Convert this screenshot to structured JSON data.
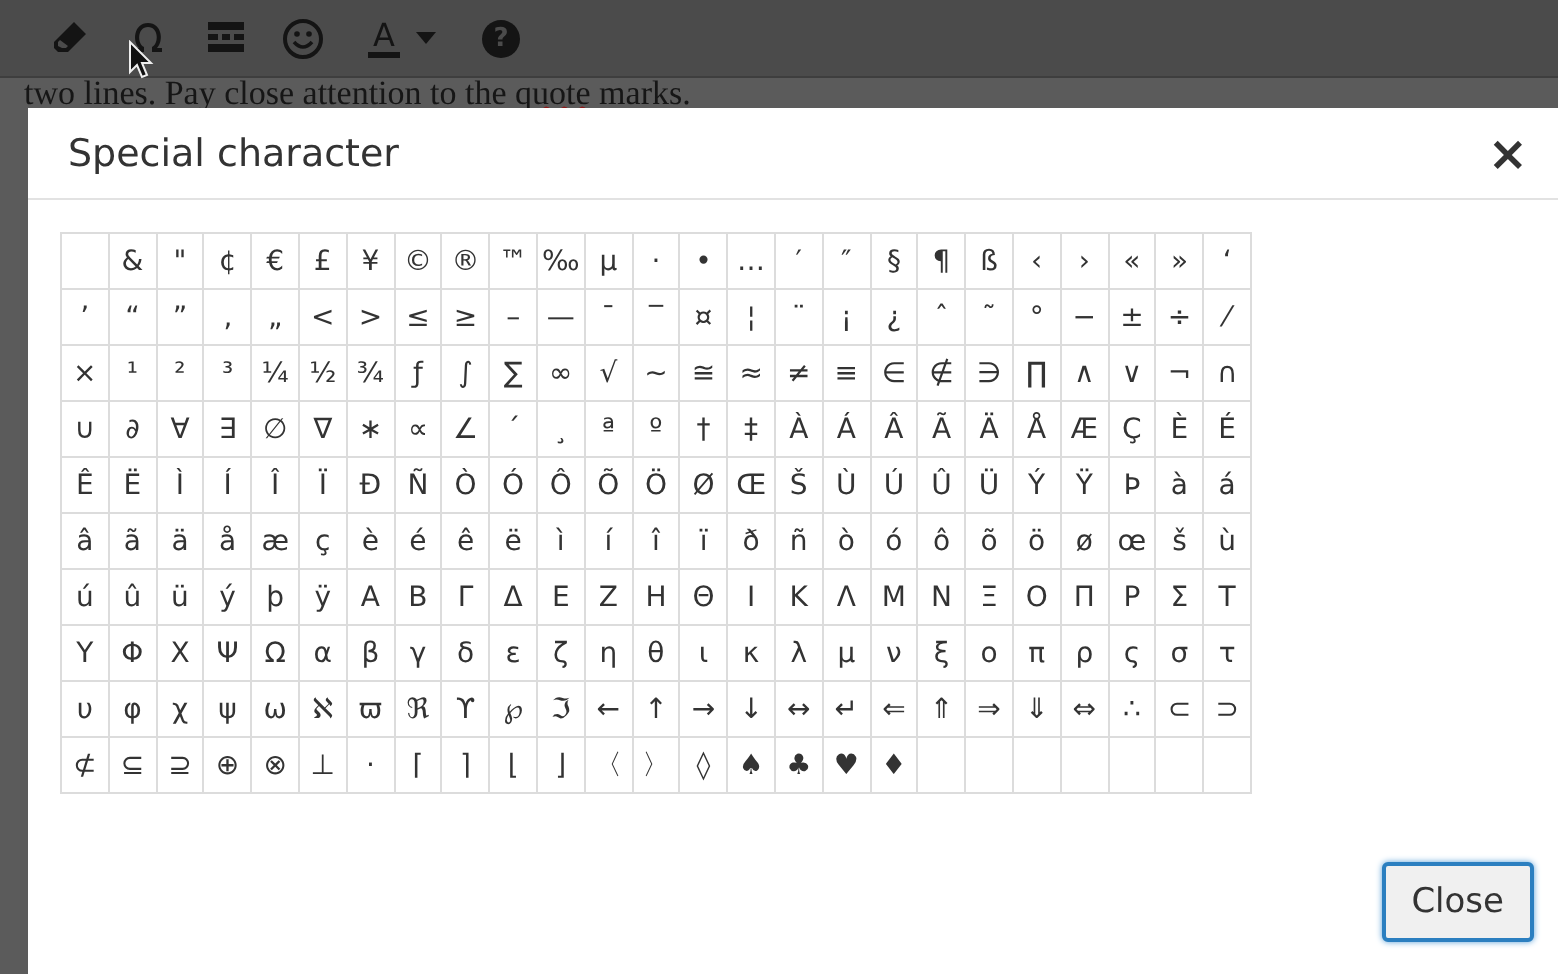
{
  "toolbar": [
    {
      "kind": "eraser"
    },
    {
      "kind": "omega"
    },
    {
      "kind": "hr"
    },
    {
      "kind": "emoticon"
    },
    {
      "kind": "textcolor",
      "glyph": "A"
    },
    {
      "kind": "help",
      "glyph": "?"
    }
  ],
  "editor_line": [
    {
      "text": "two lines. Pay close attention to the ",
      "misspelled": false
    },
    {
      "text": "quote",
      "misspelled": true
    },
    {
      "text": " marks.",
      "misspelled": false
    }
  ],
  "dialog": {
    "title": "Special character",
    "close_glyph": "×",
    "rows": [
      [
        " ",
        "&",
        "\"",
        "¢",
        "€",
        "£",
        "¥",
        "©",
        "®",
        "™",
        "‰",
        "µ",
        "·",
        "•",
        "…",
        "′",
        "″",
        "§",
        "¶",
        "ß",
        "‹",
        "›",
        "«",
        "»",
        "‘"
      ],
      [
        "’",
        "“",
        "”",
        "‚",
        "„",
        "<",
        ">",
        "≤",
        "≥",
        "–",
        "—",
        "¯",
        "‾",
        "¤",
        "¦",
        "¨",
        "¡",
        "¿",
        "ˆ",
        "˜",
        "°",
        "−",
        "±",
        "÷",
        "⁄"
      ],
      [
        "×",
        "¹",
        "²",
        "³",
        "¼",
        "½",
        "¾",
        "ƒ",
        "∫",
        "∑",
        "∞",
        "√",
        "∼",
        "≅",
        "≈",
        "≠",
        "≡",
        "∈",
        "∉",
        "∋",
        "∏",
        "∧",
        "∨",
        "¬",
        "∩"
      ],
      [
        "∪",
        "∂",
        "∀",
        "∃",
        "∅",
        "∇",
        "∗",
        "∝",
        "∠",
        "´",
        "¸",
        "ª",
        "º",
        "†",
        "‡",
        "À",
        "Á",
        "Â",
        "Ã",
        "Ä",
        "Å",
        "Æ",
        "Ç",
        "È",
        "É"
      ],
      [
        "Ê",
        "Ë",
        "Ì",
        "Í",
        "Î",
        "Ï",
        "Ð",
        "Ñ",
        "Ò",
        "Ó",
        "Ô",
        "Õ",
        "Ö",
        "Ø",
        "Œ",
        "Š",
        "Ù",
        "Ú",
        "Û",
        "Ü",
        "Ý",
        "Ÿ",
        "Þ",
        "à",
        "á"
      ],
      [
        "â",
        "ã",
        "ä",
        "å",
        "æ",
        "ç",
        "è",
        "é",
        "ê",
        "ë",
        "ì",
        "í",
        "î",
        "ï",
        "ð",
        "ñ",
        "ò",
        "ó",
        "ô",
        "õ",
        "ö",
        "ø",
        "œ",
        "š",
        "ù"
      ],
      [
        "ú",
        "û",
        "ü",
        "ý",
        "þ",
        "ÿ",
        "Α",
        "Β",
        "Γ",
        "Δ",
        "Ε",
        "Ζ",
        "Η",
        "Θ",
        "Ι",
        "Κ",
        "Λ",
        "Μ",
        "Ν",
        "Ξ",
        "Ο",
        "Π",
        "Ρ",
        "Σ",
        "Τ"
      ],
      [
        "Υ",
        "Φ",
        "Χ",
        "Ψ",
        "Ω",
        "α",
        "β",
        "γ",
        "δ",
        "ε",
        "ζ",
        "η",
        "θ",
        "ι",
        "κ",
        "λ",
        "μ",
        "ν",
        "ξ",
        "ο",
        "π",
        "ρ",
        "ς",
        "σ",
        "τ"
      ],
      [
        "υ",
        "φ",
        "χ",
        "ψ",
        "ω",
        "ℵ",
        "ϖ",
        "ℜ",
        "ϒ",
        "℘",
        "ℑ",
        "←",
        "↑",
        "→",
        "↓",
        "↔",
        "↵",
        "⇐",
        "⇑",
        "⇒",
        "⇓",
        "⇔",
        "∴",
        "⊂",
        "⊃"
      ],
      [
        "⊄",
        "⊆",
        "⊇",
        "⊕",
        "⊗",
        "⊥",
        "⋅",
        "⌈",
        "⌉",
        "⌊",
        "⌋",
        "〈",
        "〉",
        "◊",
        "♠",
        "♣",
        "♥",
        "♦"
      ]
    ],
    "buttons": [
      {
        "label": "Close",
        "focused": true
      }
    ]
  }
}
